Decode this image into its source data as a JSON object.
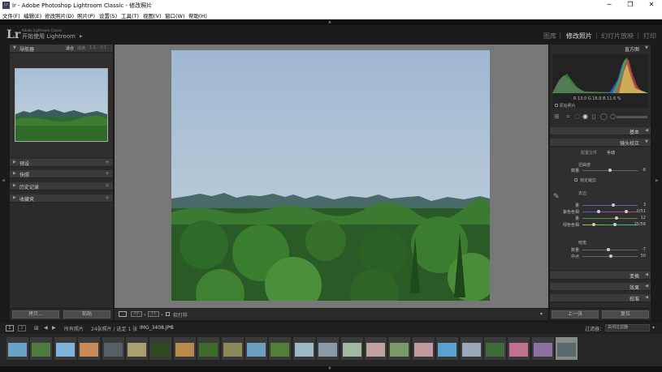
{
  "window": {
    "app_icon": "Lr",
    "title": "lr - Adobe Photoshop Lightroom Classic - 修改照片",
    "minimize": "─",
    "maximize": "❐",
    "close": "✕"
  },
  "menu": [
    "文件(F)",
    "编辑(E)",
    "修改照片(D)",
    "照片(P)",
    "设置(S)",
    "工具(T)",
    "视图(V)",
    "窗口(W)",
    "帮助(H)"
  ],
  "identity": {
    "logo": "Lr",
    "line1": "Adobe Lightroom Classic",
    "line2": "开始使用 Lightroom"
  },
  "modules": [
    "图库",
    "修改照片",
    "幻灯片放映",
    "打印"
  ],
  "active_module": "修改照片",
  "left_panel": {
    "navigator": {
      "label": "导航器",
      "zoom_options": [
        "适合",
        "填满",
        "1:1",
        "3:1"
      ]
    },
    "sections": [
      "预设",
      "快照",
      "历史记录",
      "收藏夹"
    ],
    "copy_button": "拷贝...",
    "paste_button": "粘贴"
  },
  "right_panel": {
    "histogram": {
      "label": "直方图",
      "readout": [
        "R",
        "13.0",
        "G",
        "16.9",
        "B",
        "11.6",
        "%"
      ],
      "original_label": "原始照片"
    },
    "sections_collapsed_top": [
      "基本"
    ],
    "lens": {
      "label": "镜头校正",
      "tabs": [
        "配置文件",
        "手动"
      ],
      "active_tab": "手动",
      "distortion_title": "扭曲度",
      "amount_label": "数量",
      "amount_value": "-8",
      "constrain_label": "锁定裁剪",
      "defringe_title": "去边",
      "sliders": [
        {
          "name": "量",
          "value": "3",
          "pos": 0.55
        },
        {
          "name": "紫色色相",
          "value": "0/51",
          "pos": 0.5
        },
        {
          "name": "量",
          "value": "12",
          "pos": 0.62
        },
        {
          "name": "绿色色相",
          "value": "25/58",
          "pos": 0.48
        }
      ],
      "vignette_title": "暗角",
      "vignette": [
        {
          "name": "数量",
          "value": "-7",
          "pos": 0.45
        },
        {
          "name": "中点",
          "value": "50",
          "pos": 0.5
        }
      ]
    },
    "sections_bottom": [
      "变换",
      "效果",
      "校准"
    ],
    "prev_button": "上一张",
    "reset_button": "复位"
  },
  "toolbar": {
    "soft_proof_label": "软打样"
  },
  "filmstrip_bar": {
    "page1": "1",
    "page2": "2",
    "source": "所有照片",
    "count": "24张照片 / 选定 1 张",
    "filename": "IMG_3408.JPG",
    "filter_label": "过滤器：",
    "filter_value": "关闭过滤器"
  },
  "filmstrip": {
    "thumbs": [
      "#6aa3c8",
      "#4d7a3e",
      "#7fb3d9",
      "#c98a5a",
      "#556066",
      "#a8a070",
      "#2c4a1e",
      "#b88a4a",
      "#3d6b2a",
      "#8a8a5a",
      "#6e9fc0",
      "#4f7f38",
      "#9fb8c9",
      "#8a9aa8",
      "#a0b89f",
      "#c0a0a0",
      "#7a9a6a",
      "#c09aa0",
      "#5aa0d0",
      "#9aa8b8",
      "#3f6a3a",
      "#c07090",
      "#8a70a0",
      "#5a6a6a"
    ]
  },
  "colors": {
    "panel_bg": "#2b2b2b",
    "center_bg": "#777777",
    "header_bg": "#1b1b1b",
    "text_active": "#e0e0e0"
  }
}
